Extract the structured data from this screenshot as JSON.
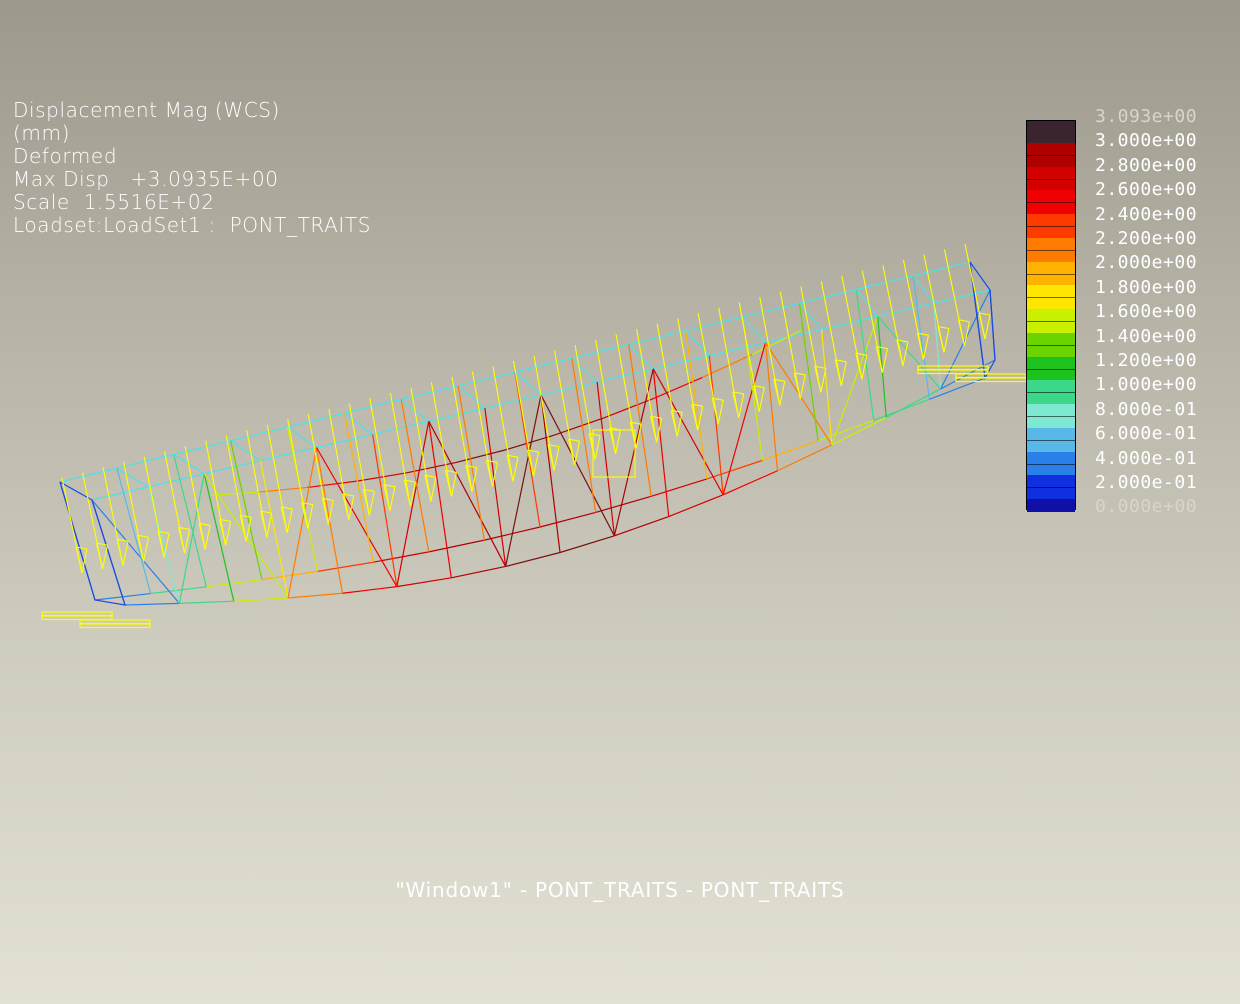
{
  "info": {
    "result": "Displacement Mag (WCS)",
    "units": "(mm)",
    "mode": "Deformed",
    "max_disp": "Max Disp   +3.0935E+00",
    "scale": "Scale  1.5516E+02",
    "loadset": "Loadset:LoadSet1 :  PONT_TRAITS"
  },
  "legend": {
    "labels": [
      "3.093e+00",
      "3.000e+00",
      "2.800e+00",
      "2.600e+00",
      "2.400e+00",
      "2.200e+00",
      "2.000e+00",
      "1.800e+00",
      "1.600e+00",
      "1.400e+00",
      "1.200e+00",
      "1.000e+00",
      "8.000e-01",
      "6.000e-01",
      "4.000e-01",
      "2.000e-01",
      "0.000e+00"
    ],
    "colors": [
      "#3a2430",
      "#b00000",
      "#d40000",
      "#f00000",
      "#ff3a00",
      "#ff7a00",
      "#ffb300",
      "#ffe600",
      "#c8f000",
      "#6ad400",
      "#1ec21e",
      "#3cd88a",
      "#7fe8d2",
      "#58b8e8",
      "#2880e8",
      "#1030e0",
      "#1010a8"
    ]
  },
  "footer": "\"Window1\" - PONT_TRAITS - PONT_TRAITS"
}
